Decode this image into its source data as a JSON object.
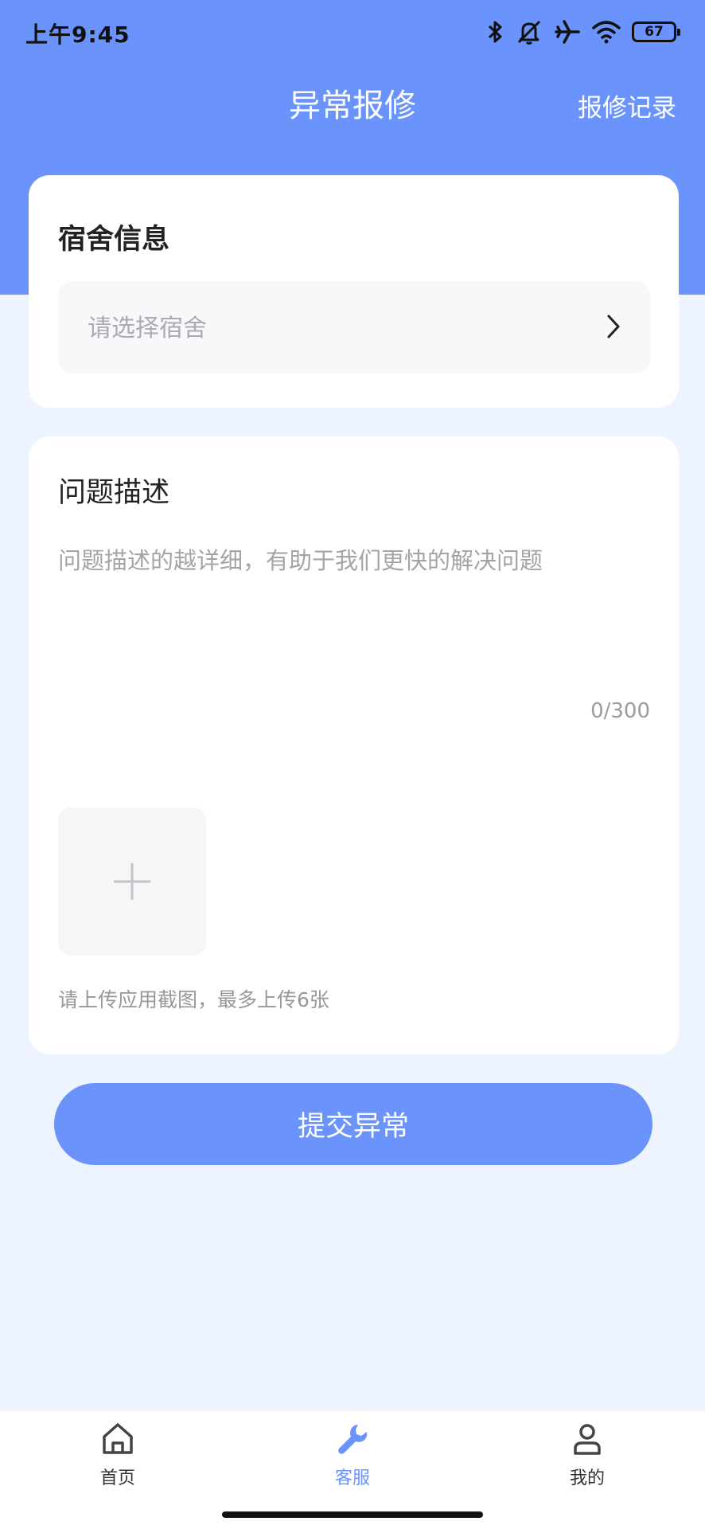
{
  "status_bar": {
    "time": "上午9:45",
    "battery": "67",
    "icons": [
      "bluetooth-icon",
      "bell-muted-icon",
      "airplane-icon",
      "wifi-icon",
      "battery-icon"
    ]
  },
  "nav": {
    "title": "异常报修",
    "right_link": "报修记录"
  },
  "dorm_card": {
    "title": "宿舍信息",
    "select_placeholder": "请选择宿舍"
  },
  "desc_card": {
    "title": "问题描述",
    "placeholder": "问题描述的越详细，有助于我们更快的解决问题",
    "counter": "0/300",
    "upload_hint": "请上传应用截图，最多上传6张"
  },
  "submit": {
    "label": "提交异常"
  },
  "tabbar": {
    "items": [
      {
        "label": "首页",
        "icon": "home-icon",
        "active": false
      },
      {
        "label": "客服",
        "icon": "wrench-icon",
        "active": true
      },
      {
        "label": "我的",
        "icon": "user-icon",
        "active": false
      }
    ]
  },
  "colors": {
    "primary": "#6b93fc",
    "page_bg": "#edf3ff"
  }
}
